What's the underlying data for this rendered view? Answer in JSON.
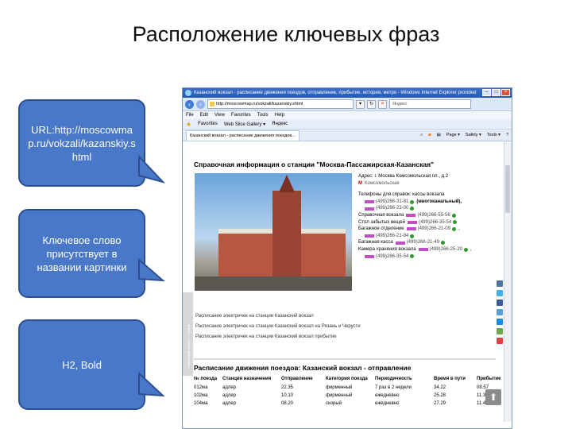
{
  "slide": {
    "title": "Расположение ключевых фраз"
  },
  "callouts": [
    {
      "text": "URL:http://moscowmap.ru/vokzali/kazanskiy.shtml"
    },
    {
      "text": "Ключевое слово присутствует в названии картинки"
    },
    {
      "text": "H2, Bold"
    }
  ],
  "browser": {
    "window_title": "Казанский вокзал - расписание движения поездов, отправление, прибытие, история, метро - Windows Internet Explorer provided",
    "url": "http://moscowmap.ru/vokzali/kazanskiy.shtml",
    "search_placeholder": "Яндекс",
    "menu": [
      "File",
      "Edit",
      "View",
      "Favorites",
      "Tools",
      "Help"
    ],
    "favorites": [
      "Favorites",
      "Web Slice Gallery ▾",
      "Яндекс"
    ],
    "tab": "Казанский вокзал - расписание движения поездов...",
    "tools": [
      "Page ▾",
      "Safety ▾",
      "Tools ▾",
      "?"
    ],
    "sidestrip_text": "Казанский вокзал – схема"
  },
  "page": {
    "h2": "Справочная информация о станции \"Москва-Пассажирская-Казанская\"",
    "address": "Адрес: г. Москва Комсомольская пл., д.2",
    "metro": "Комсомольская",
    "phones_title": "Телефоны для справок: кассы вокзала",
    "phones": [
      {
        "label": "",
        "number": "(499)266-31-81",
        "extra": "(многоканальный),"
      },
      {
        "label": "",
        "number": "(499)266-23-00",
        "extra": ""
      },
      {
        "label": "Справочная вокзала",
        "number": "(499)266-55-56",
        "extra": ""
      },
      {
        "label": "Стол забытых вещей",
        "number": "(499)266-35-54",
        "extra": ""
      },
      {
        "label": "Багажное отделение",
        "number": "(499)266-21-09",
        "extra": ","
      },
      {
        "label": "",
        "number": "(499)266-21-84",
        "extra": ""
      },
      {
        "label": "Багажная касса",
        "number": "(499)266-21-49",
        "extra": ""
      },
      {
        "label": "Камера хранения вокзала",
        "number": "(499)266-25-20",
        "extra": ","
      },
      {
        "label": "",
        "number": "(499)266-35-54",
        "extra": ""
      }
    ],
    "links": [
      "Расписание электричек на станции Казанский вокзал",
      "Расписание электричек на станции Казанский вокзал на Рязань и Черусти",
      "Расписание электричек на станции Казанский вокзал прибытие"
    ],
    "schedule_title": "Расписание движения поездов: Казанский вокзал - отправление",
    "schedule_headers": [
      "№ поезда",
      "Станция назначения",
      "Отправление",
      "Категория поезда",
      "Периодичность",
      "Время в пути",
      "Прибытие"
    ],
    "schedule_rows": [
      [
        "012ма",
        "адлер",
        "22.35",
        "фирменный",
        "7 раз в 2 недели",
        "34.22",
        "08.57"
      ],
      [
        "102ма",
        "адлер",
        "10.10",
        "фирменный",
        "ежедневно",
        "25.28",
        "11.38"
      ],
      [
        "104ма",
        "адлер",
        "08.20",
        "скорый",
        "ежедневно",
        "27.29",
        "11.49"
      ]
    ],
    "up_button": "Наверх"
  },
  "colors": {
    "callout_fill": "#4a78c8",
    "callout_border": "#2c4f8f",
    "phone_marker": "#c04fc6"
  }
}
